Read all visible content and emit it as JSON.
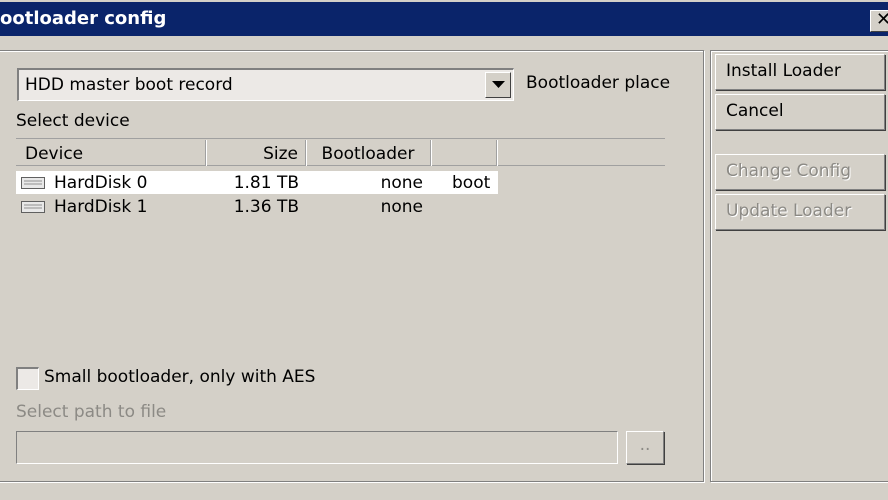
{
  "window": {
    "title": "ootloader config",
    "close_glyph": "✕"
  },
  "combo": {
    "value": "HDD master boot record",
    "label": "Bootloader place"
  },
  "device_section": {
    "label": "Select device"
  },
  "table": {
    "headers": [
      "Device",
      "Size",
      "Bootloader",
      ""
    ],
    "rows": [
      {
        "device": "HardDisk 0",
        "size": "1.81 TB",
        "bootloader": "none",
        "flag": "boot"
      },
      {
        "device": "HardDisk 1",
        "size": "1.36 TB",
        "bootloader": "none",
        "flag": ""
      }
    ]
  },
  "options": {
    "small_bootloader": "Small bootloader, only with AES",
    "path_label": "Select path to file",
    "path_value": "",
    "browse": ".."
  },
  "buttons": {
    "install": "Install Loader",
    "cancel": "Cancel",
    "change_config": "Change Config",
    "update_loader": "Update Loader"
  }
}
